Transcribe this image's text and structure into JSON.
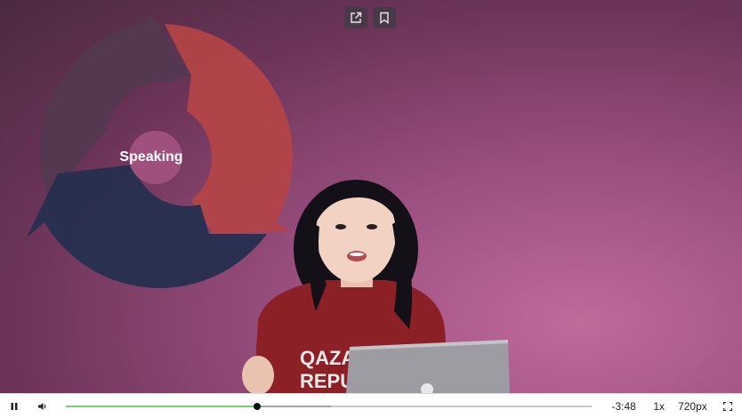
{
  "video": {
    "diagram_label": "Speaking",
    "shirt_text_line1": "QAZA",
    "shirt_text_line2": "REPU"
  },
  "top_actions": {
    "share_icon": "share-icon",
    "bookmark_icon": "bookmark-icon"
  },
  "controls": {
    "play_state_icon": "pause-icon",
    "volume_icon": "volume-icon",
    "progress_played": 0.365,
    "progress_buffered": 0.505,
    "time_remaining": "-3:48",
    "speed": "1x",
    "quality": "720px",
    "fullscreen_icon": "fullscreen-icon"
  },
  "colors": {
    "played": "#7cc87c",
    "buffered": "#9aa7b8",
    "background": "#a4578a"
  }
}
